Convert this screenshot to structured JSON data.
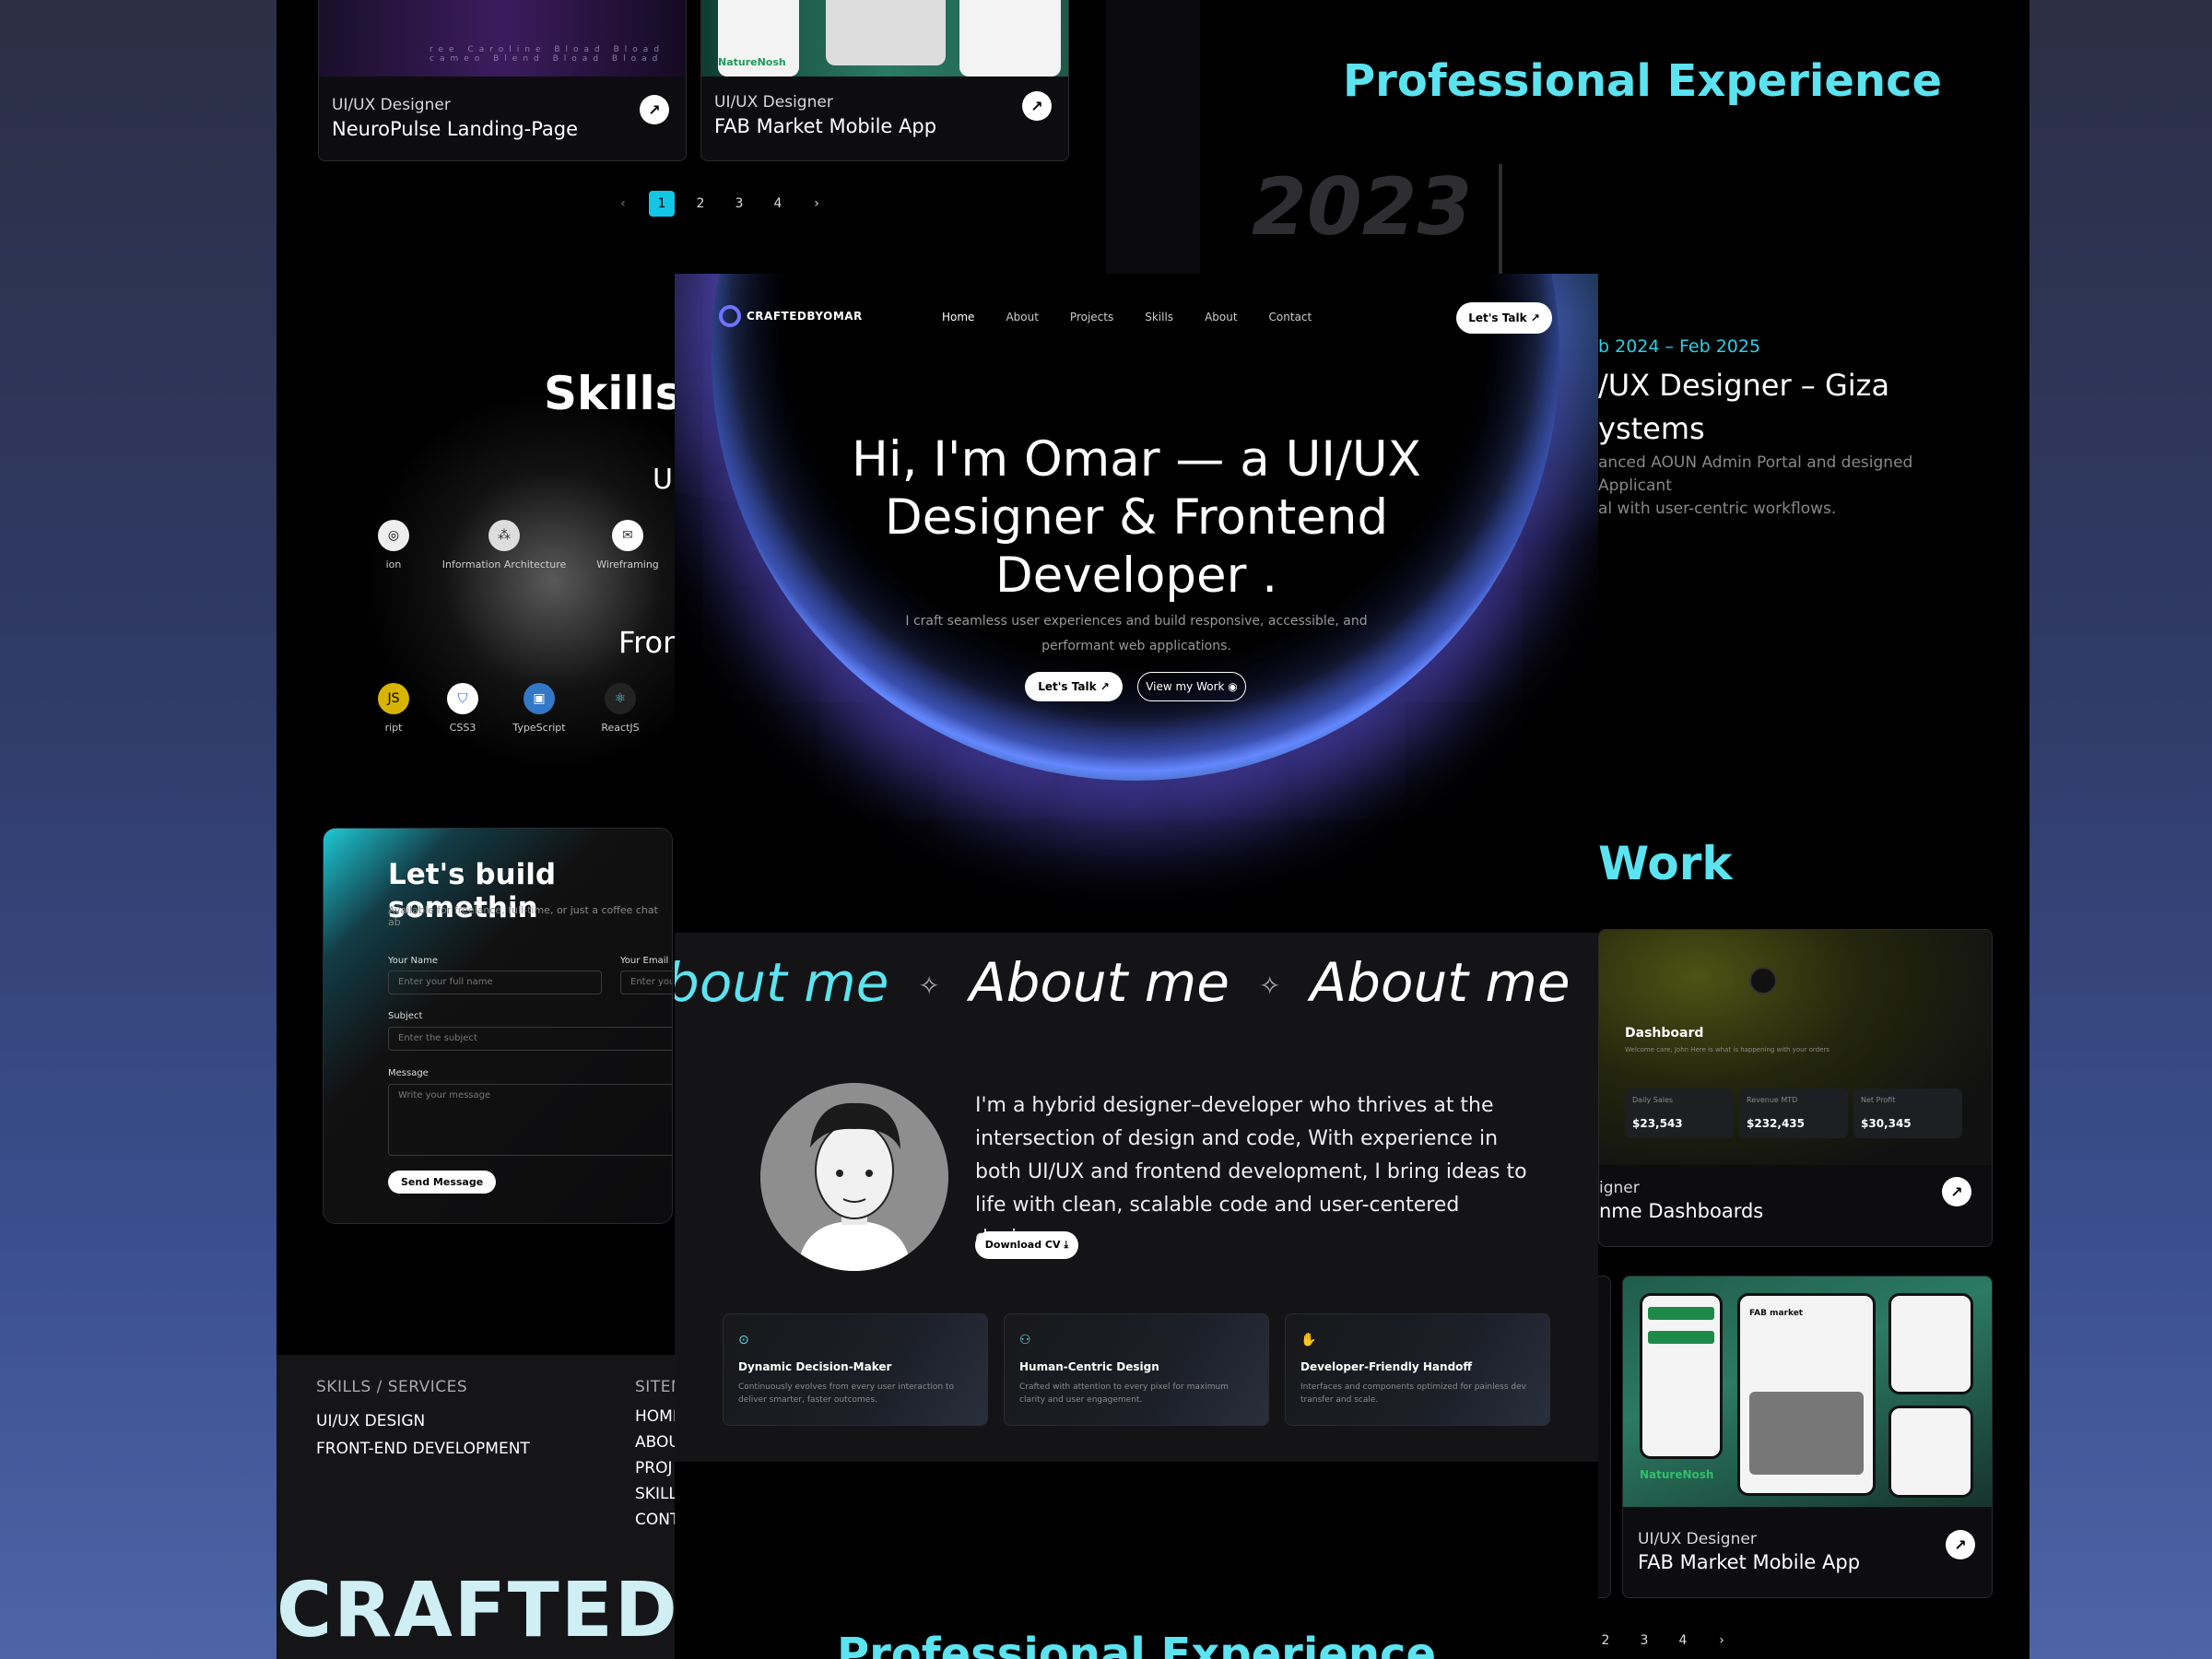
{
  "top_projects": [
    {
      "role": "UI/UX Designer",
      "title": "NeuroPulse Landing-Page"
    },
    {
      "role": "UI/UX Designer",
      "title": "FAB Market Mobile App"
    }
  ],
  "pager": {
    "prev": "‹",
    "pages": [
      "1",
      "2",
      "3",
      "4"
    ],
    "next": "›",
    "active": "1"
  },
  "skills": {
    "title": "Skills",
    "group1_partial": "U",
    "group1_items": [
      "ion",
      "Information Architecture",
      "Wireframing"
    ],
    "group2_partial": "Fron",
    "group2_items": [
      "ript",
      "CSS3",
      "TypeScript",
      "ReactJS"
    ]
  },
  "contact": {
    "title": "Let's build somethin",
    "subtitle": "Available for freelance, full-time, or just a coffee chat ab",
    "name_label": "Your Name",
    "name_placeholder": "Enter your full name",
    "email_label": "Your Email",
    "email_placeholder": "Enter you",
    "subject_label": "Subject",
    "subject_placeholder": "Enter the subject",
    "message_label": "Message",
    "message_placeholder": "Write your message",
    "send_label": "Send Message"
  },
  "footer": {
    "skills_head": "SKILLS / SERVICES",
    "skills_items": [
      "UI/UX DESIGN",
      "FRONT-END DEVELOPMENT"
    ],
    "sitemap_head": "SITEM",
    "sitemap_items": [
      "HOMI",
      "ABOU",
      "PROJ",
      "SKILL",
      "CONT"
    ],
    "brand": "CRAFTED"
  },
  "right": {
    "exp_title": "Professional Experience",
    "year": "2023",
    "exp_date": "b 2024 – Feb 2025",
    "exp_role_line1": "/UX Designer – Giza",
    "exp_role_line2": "ystems",
    "exp_desc_line1": "anced AOUN Admin Portal and designed Applicant",
    "exp_desc_line2": "al with user-centric workflows.",
    "work_title": "Work",
    "dash_card": {
      "heading": "Dashboard",
      "subhead": "Welcome care, John Here is what is happening with your orders",
      "stats": [
        {
          "label": "Daily Sales",
          "value": "$23,543"
        },
        {
          "label": "Revenue MTD",
          "value": "$232,435"
        },
        {
          "label": "Net Profit",
          "value": "$30,345"
        }
      ],
      "role": "igner",
      "title": "nme Dashboards"
    },
    "fab_card": {
      "role": "UI/UX Designer",
      "title": "FAB Market Mobile App",
      "brand1": "FAB market",
      "brand2": "NatureNosh"
    },
    "pager_pages": [
      "2",
      "3",
      "4"
    ],
    "pager_next": "›"
  },
  "main": {
    "logo": "CRAFTEDBYOMAR",
    "nav": [
      "Home",
      "About",
      "Projects",
      "Skills",
      "About",
      "Contact"
    ],
    "talk_button": "Let's Talk ↗",
    "hero_title": "Hi, I'm Omar — a UI/UX Designer & Frontend Developer .",
    "hero_sub": "I craft seamless user experiences and build responsive, accessible, and performant web applications.",
    "cta_talk": "Let's Talk ↗",
    "cta_work": "View my Work ◉",
    "marquee": [
      "bout me",
      "About me",
      "About me"
    ],
    "about_text": "I'm a hybrid designer–developer who thrives at the intersection of design and code, With experience in both UI/UX and frontend development, I bring ideas to life with clean, scalable code and user-centered design.",
    "cv_button": "Download CV ⤓",
    "features": [
      {
        "title": "Dynamic Decision-Maker",
        "desc": "Continuously evolves from every user interaction to deliver smarter, faster outcomes."
      },
      {
        "title": "Human-Centric Design",
        "desc": "Crafted with attention to every pixel for maximum clarity and user engagement."
      },
      {
        "title": "Developer-Friendly Handoff",
        "desc": "Interfaces and components optimized for painless dev transfer and scale."
      }
    ],
    "bottom_title": "Professional Experience"
  },
  "colors": {
    "accent_cyan": "#5be3f0",
    "pager_active": "#12c6e6",
    "hero_ring": "#6e74ff"
  }
}
